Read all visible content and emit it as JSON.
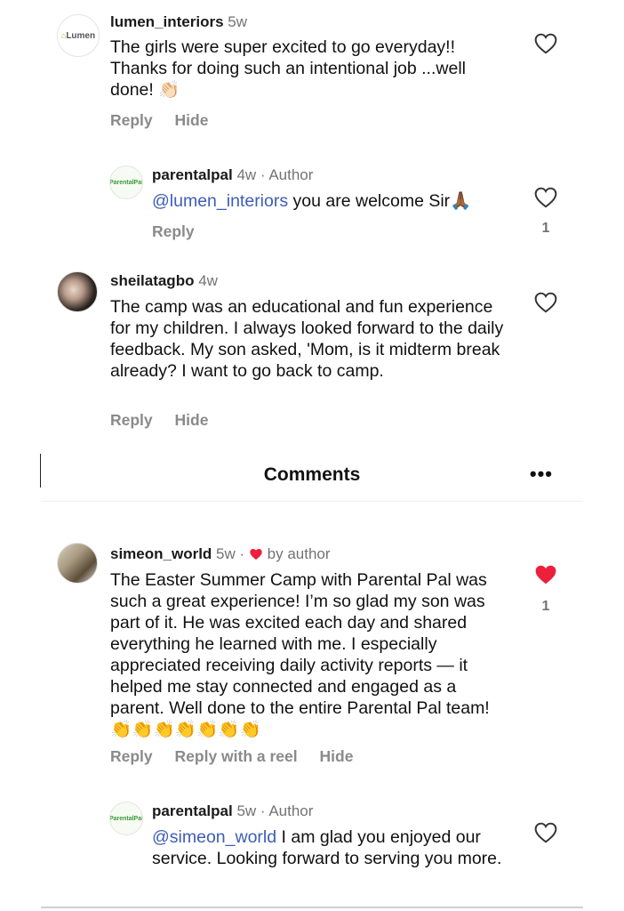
{
  "comments": [
    {
      "username": "lumen_interiors",
      "time": "5w",
      "text": "The girls were super excited to go everyday!! Thanks for doing such an intentional job ...well done! 👏🏻",
      "reply_label": "Reply",
      "hide_label": "Hide",
      "avatar_text": "Lumen"
    },
    {
      "username": "parentalpal",
      "time": "4w · Author",
      "mention": "@lumen_interiors",
      "text": " you are welcome Sir🙏🏾",
      "reply_label": "Reply",
      "like_count": "1"
    },
    {
      "username": "sheilatagbo",
      "time": "4w",
      "text": "The camp was an educational and fun experience for my children. I always looked forward to the daily feedback. My son asked, 'Mom, is it midterm break already? I want to go back to camp.",
      "reply_label": "Reply",
      "hide_label": "Hide"
    },
    {
      "username": "simeon_world",
      "time": "5w ·",
      "by_author": "by author",
      "text": "The Easter Summer Camp with Parental Pal was such a great experience! I’m so glad my son was part of it. He was excited each day and shared everything he learned with me. I especially appreciated receiving daily activity reports — it helped me stay connected and engaged as a parent. Well done to the entire Parental Pal team! 👏👏👏👏👏👏👏",
      "reply_label": "Reply",
      "reel_label": "Reply with a reel",
      "hide_label": "Hide",
      "like_count": "1"
    },
    {
      "username": "parentalpal",
      "time": "5w · Author",
      "mention": "@simeon_world",
      "text": " I am glad you enjoyed our service. Looking forward to serving you more."
    }
  ],
  "header": {
    "title": "Comments",
    "more_icon": "•••"
  },
  "colors": {
    "accent_blue": "#3d5db8",
    "liked_red": "#ed1f3a",
    "muted": "#737373"
  }
}
